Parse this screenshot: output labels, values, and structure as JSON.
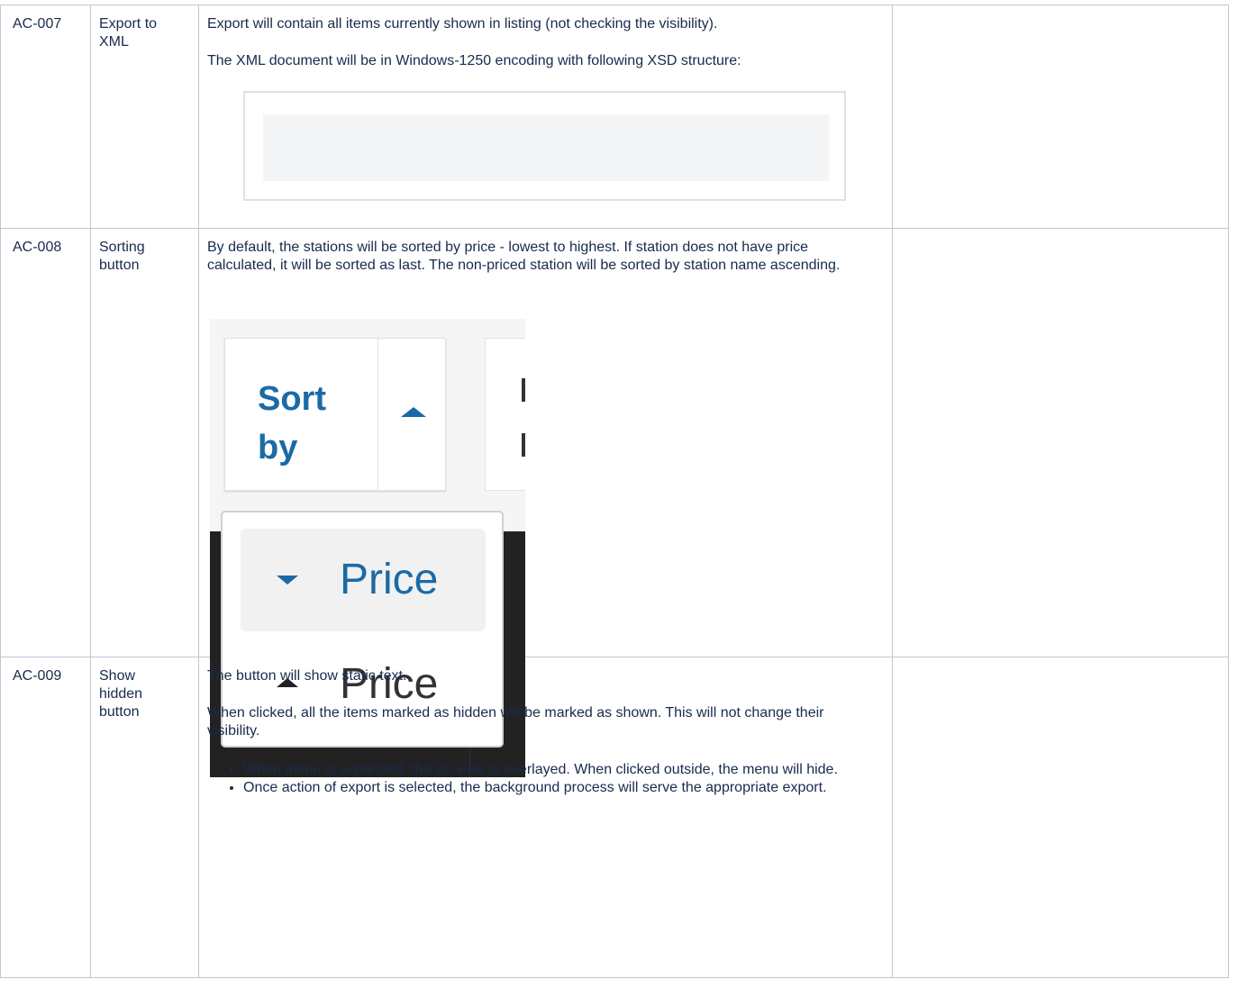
{
  "rows": [
    {
      "id": "AC-007",
      "name": "Export to XML",
      "p1": "Export will contain all items currently shown in listing (not checking the visibility).",
      "p2": "The XML document will be in Windows-1250 encoding with following XSD structure:"
    },
    {
      "id": "AC-008",
      "name": "Sorting button",
      "p1": "By default, the stations will be sorted by price - lowest to highest. If station does not have price calculated, it will be sorted as last. The non-priced station will be sorted by station name ascending.",
      "sort_button_label": "Sort by",
      "menu_items": [
        {
          "label": "Price",
          "direction": "descending",
          "icon": "caret-down-icon"
        },
        {
          "label": "Price",
          "direction": "ascending",
          "icon": "caret-up-icon"
        }
      ],
      "bullets": [
        "When menu is expanded, the list view is overlayed. When clicked outside, the menu will hide.",
        "Once action of export is selected, the background process will serve the appropriate export."
      ]
    },
    {
      "id": "AC-009",
      "name": "Show hidden button",
      "p1": "The button will show static text.",
      "p2": "When clicked, all the items marked as hidden will be marked as shown. This will not change their visibility."
    }
  ],
  "colors": {
    "text": "#172b4d",
    "border": "#c1c7d0",
    "link_blue": "#1b6aa5",
    "code_bg": "#f4f5f7"
  }
}
